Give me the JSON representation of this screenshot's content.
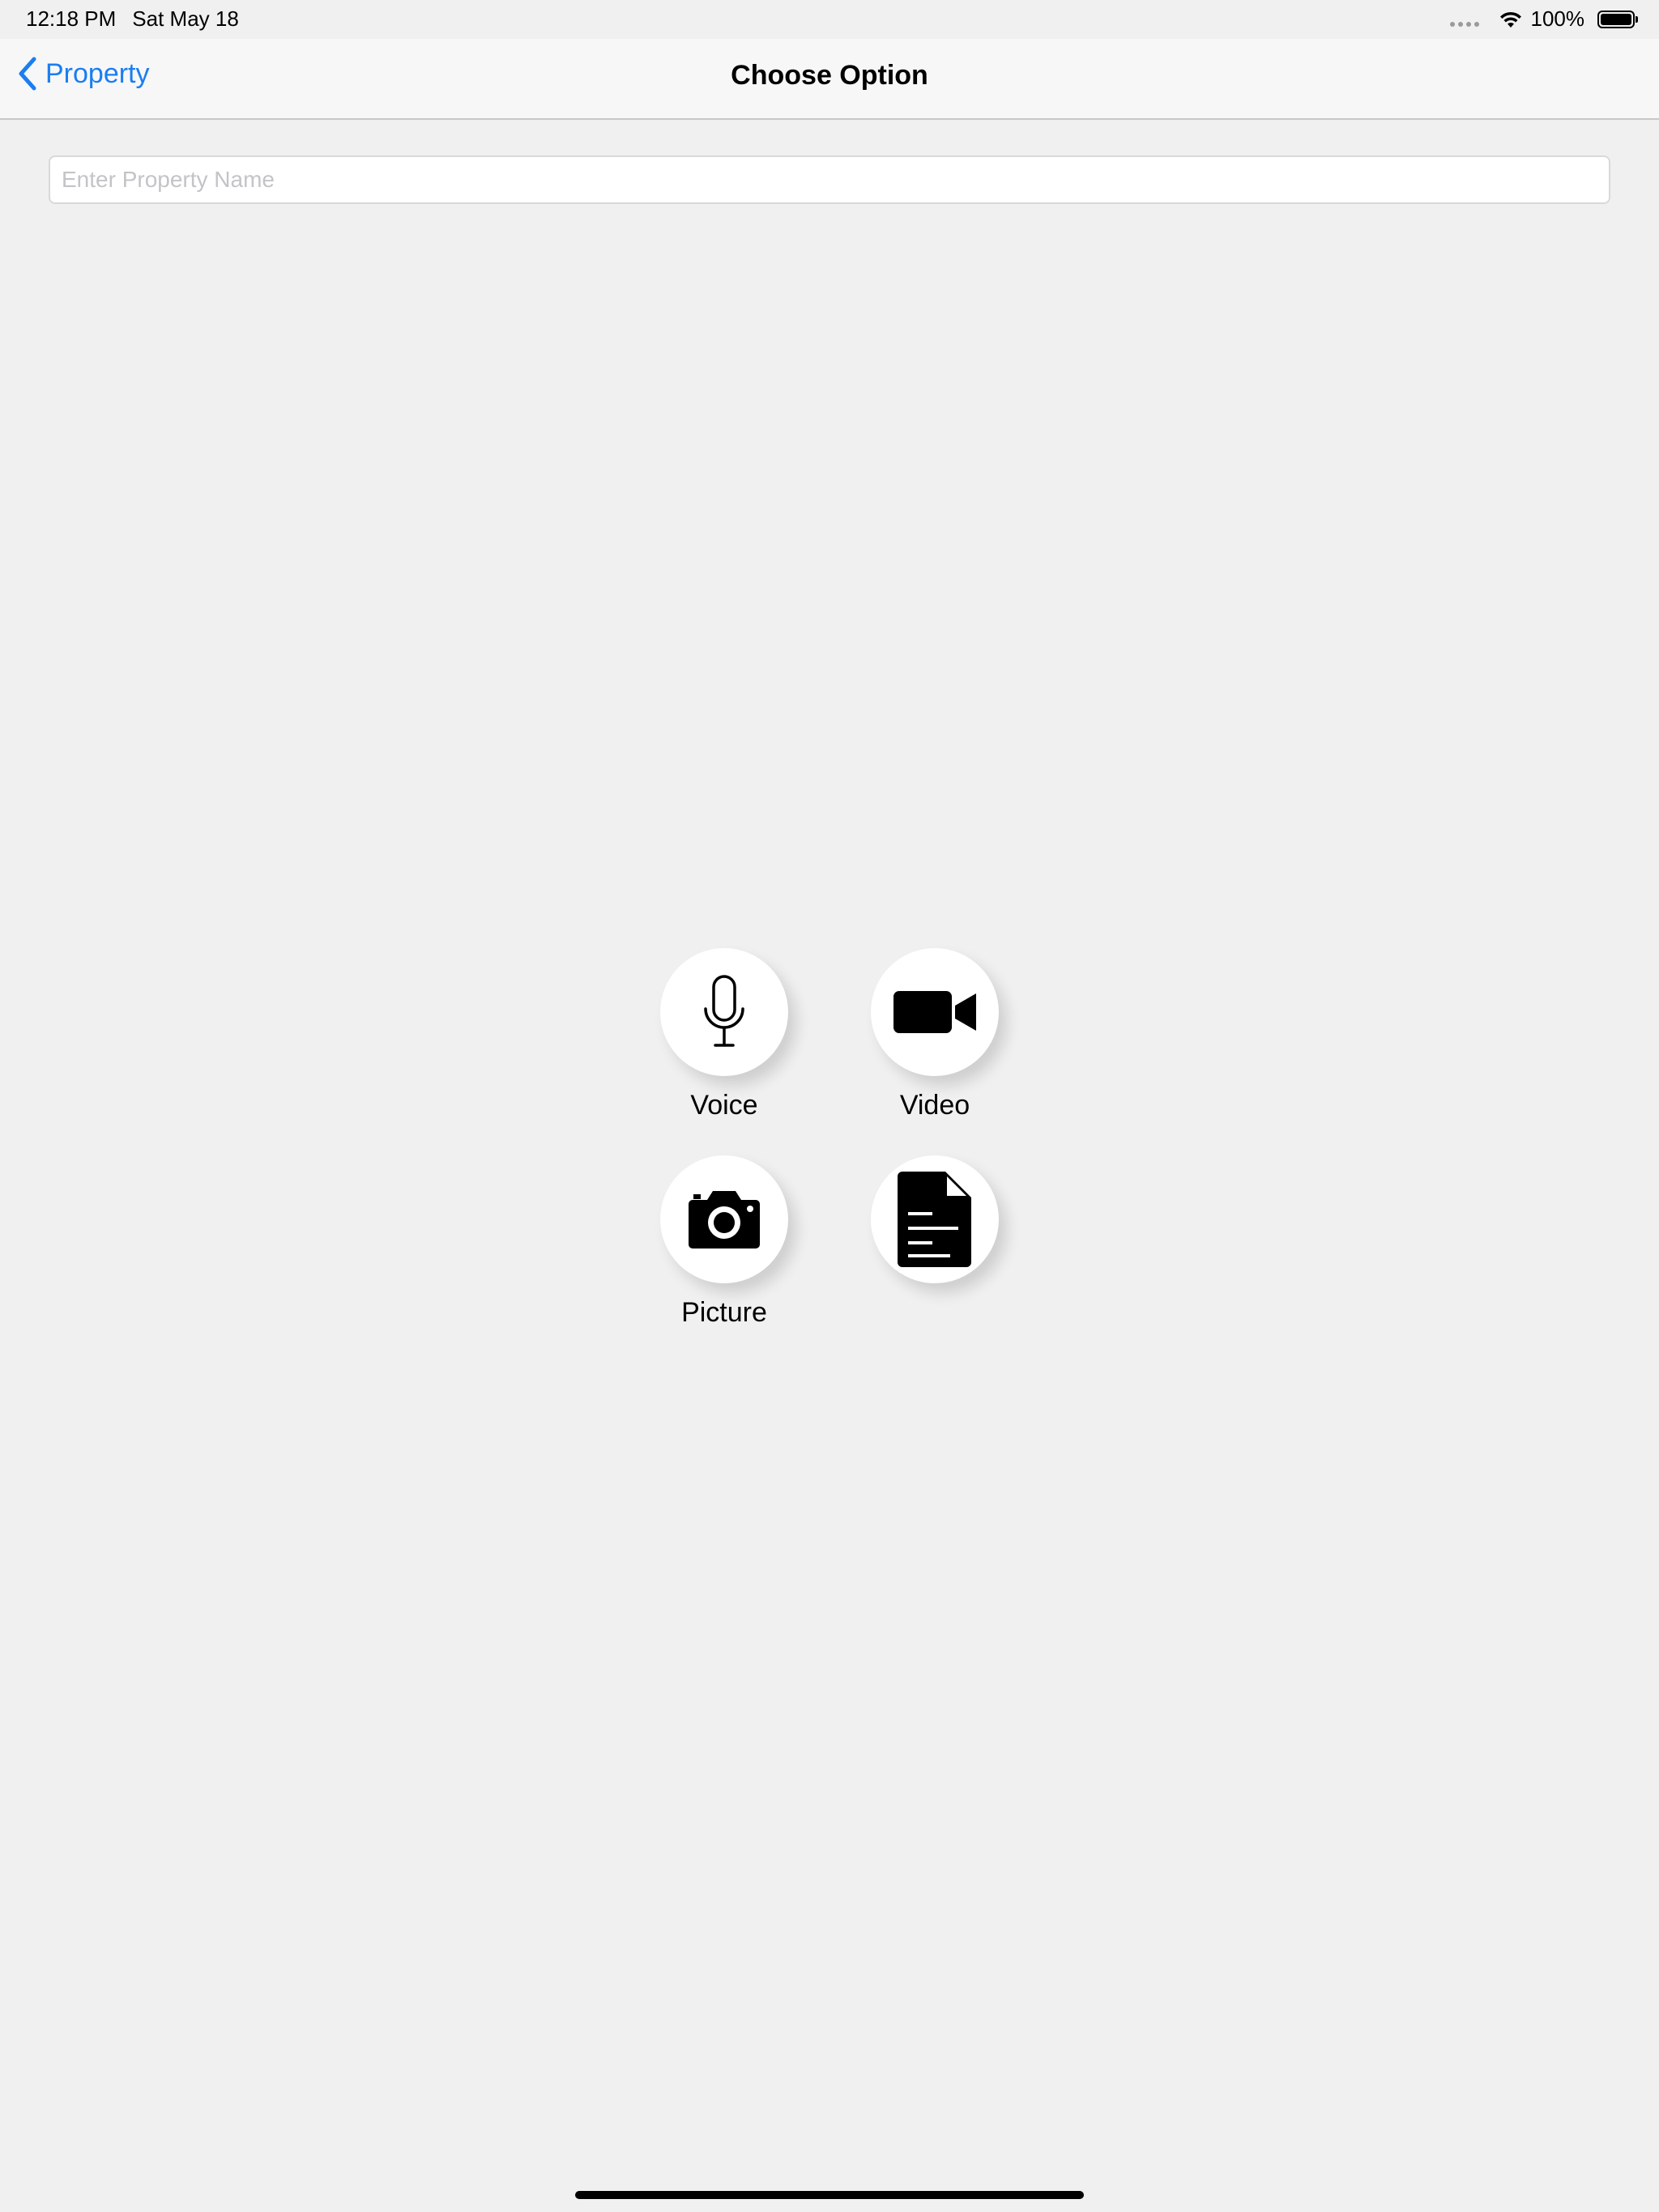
{
  "status_bar": {
    "time": "12:18 PM",
    "date": "Sat May 18",
    "battery": "100%"
  },
  "nav": {
    "back_label": "Property",
    "title": "Choose Option"
  },
  "form": {
    "property_name_placeholder": "Enter Property Name",
    "property_name_value": ""
  },
  "options": [
    {
      "label": "Voice",
      "icon": "microphone-icon"
    },
    {
      "label": "Video",
      "icon": "video-camera-icon"
    },
    {
      "label": "Picture",
      "icon": "camera-icon"
    },
    {
      "label": "",
      "icon": "document-icon"
    }
  ],
  "colors": {
    "accent": "#1a7ef0",
    "background": "#f0f0f0"
  }
}
